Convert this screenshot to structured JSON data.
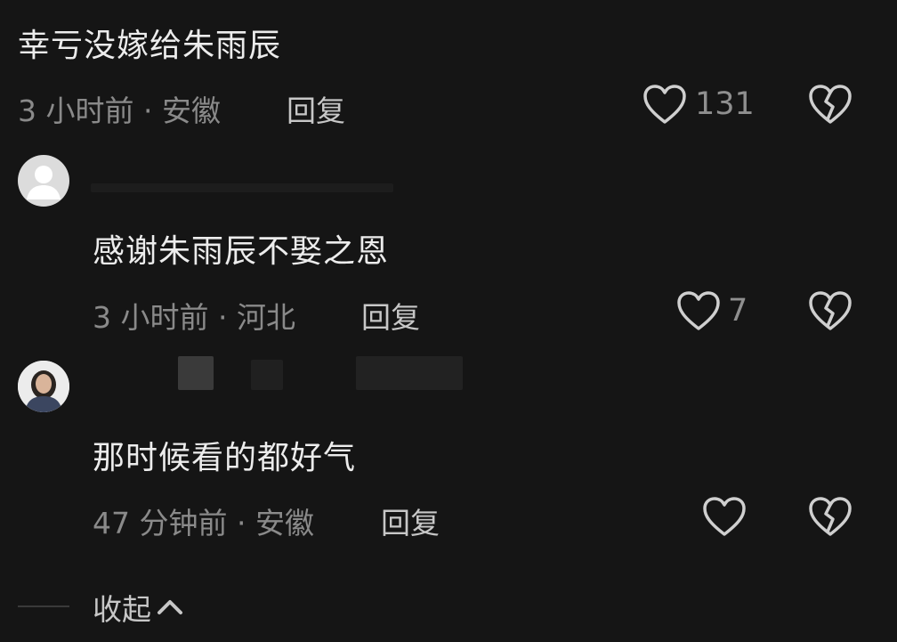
{
  "comment_top": {
    "text": "幸亏没嫁给朱雨辰",
    "time_location": "3 小时前 · 安徽",
    "reply_label": "回复",
    "like_count": "131"
  },
  "reply_1": {
    "text": "感谢朱雨辰不娶之恩",
    "time_location": "3 小时前 · 河北",
    "reply_label": "回复",
    "like_count": "7"
  },
  "reply_2": {
    "text": "那时候看的都好气",
    "time_location": "47 分钟前 · 安徽",
    "reply_label": "回复",
    "like_count": ""
  },
  "collapse": {
    "label": "收起"
  },
  "colors": {
    "background": "#151515",
    "primary_text": "#ececec",
    "secondary_text": "#8a8a8a",
    "icon": "#cfcfcf"
  },
  "icons": {
    "like": "heart-outline-icon",
    "dislike": "broken-heart-icon",
    "collapse": "chevron-up-icon",
    "default_avatar": "default-avatar-icon"
  }
}
